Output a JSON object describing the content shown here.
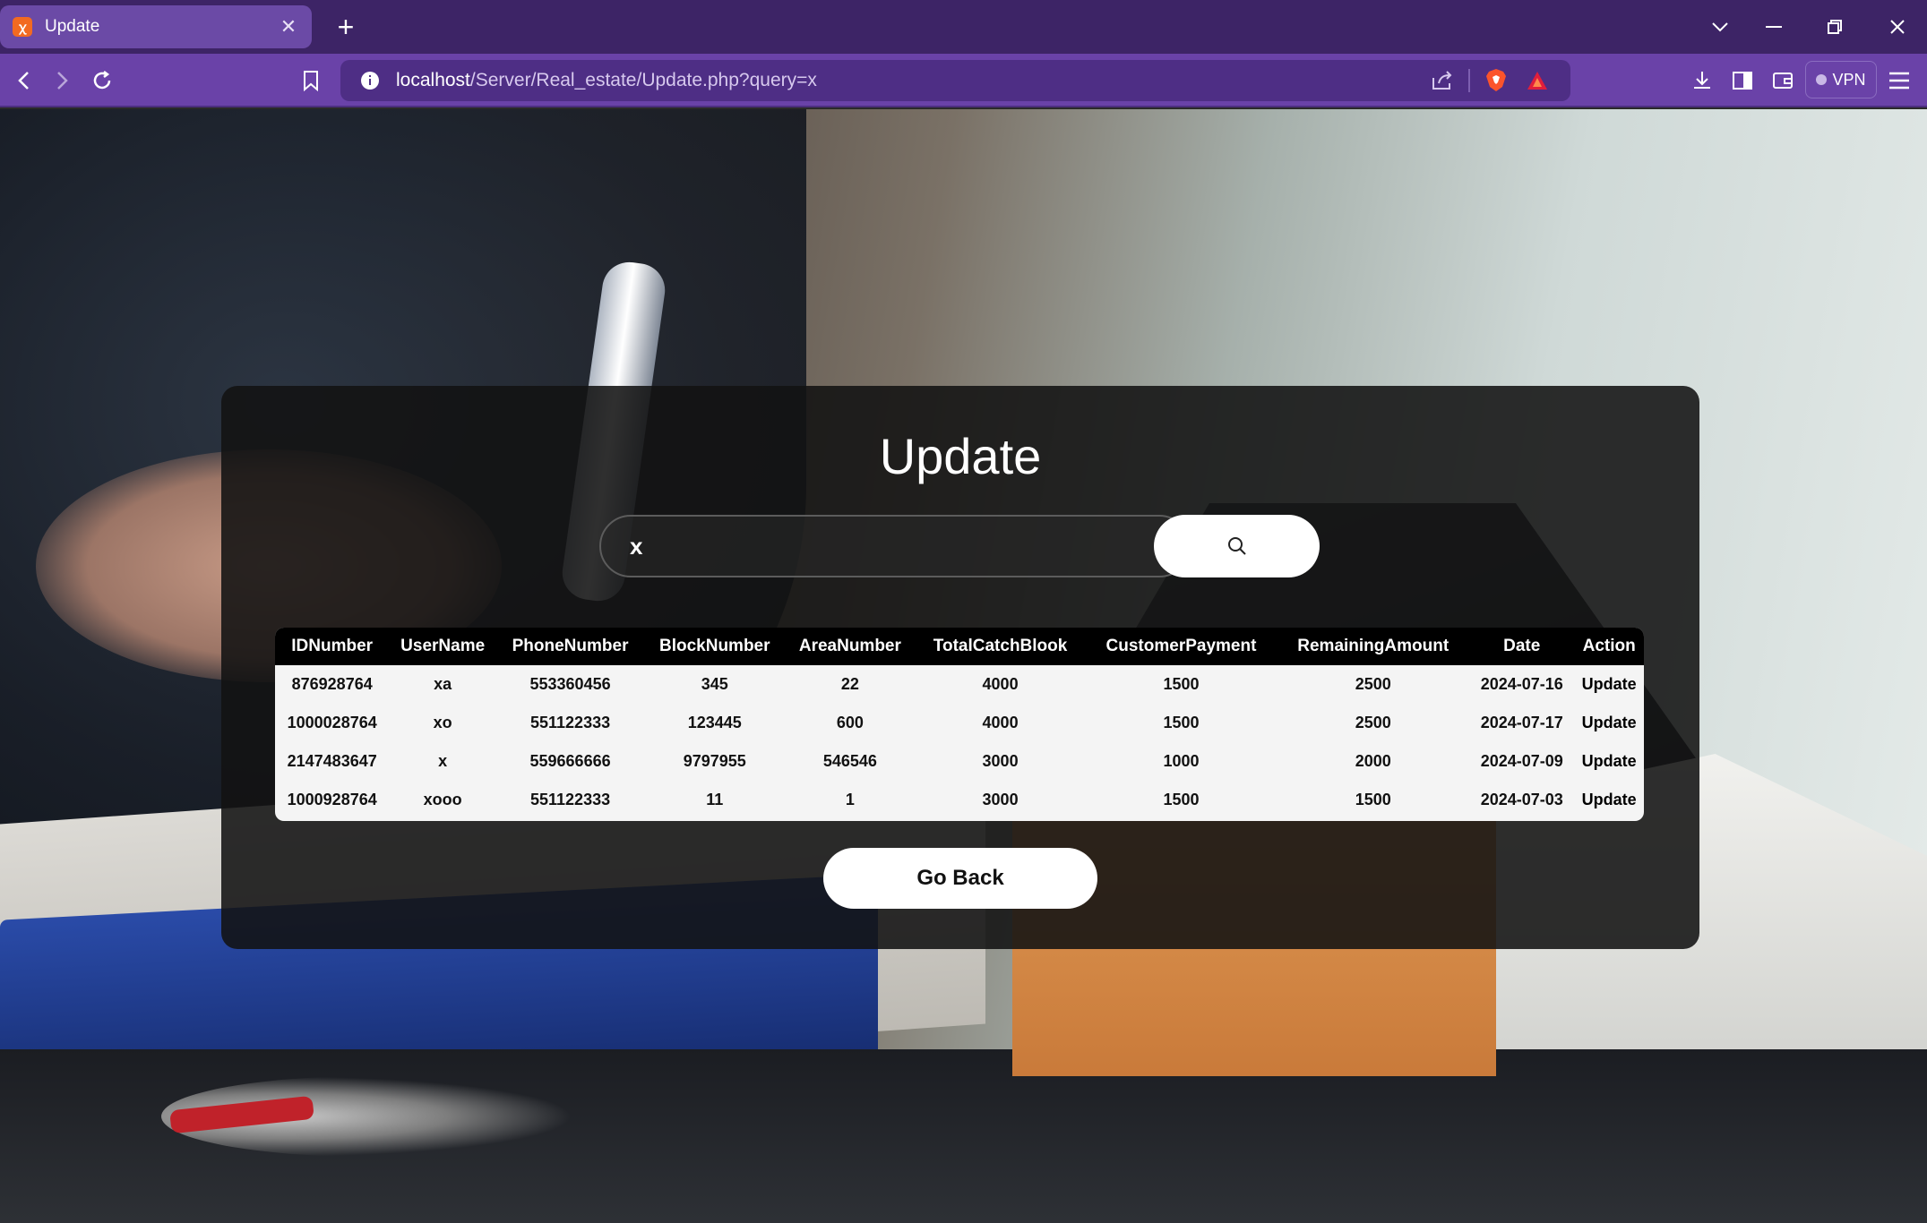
{
  "browser": {
    "tab_title": "Update",
    "url_host": "localhost",
    "url_path": "/Server/Real_estate/Update.php?query=x",
    "vpn_label": "VPN"
  },
  "page": {
    "title": "Update",
    "search": {
      "value": "x"
    },
    "table": {
      "headers": [
        "IDNumber",
        "UserName",
        "PhoneNumber",
        "BlockNumber",
        "AreaNumber",
        "TotalCatchBlook",
        "CustomerPayment",
        "RemainingAmount",
        "Date",
        "Action"
      ],
      "rows": [
        [
          "876928764",
          "xa",
          "553360456",
          "345",
          "22",
          "4000",
          "1500",
          "2500",
          "2024-07-16",
          "Update"
        ],
        [
          "1000028764",
          "xo",
          "551122333",
          "123445",
          "600",
          "4000",
          "1500",
          "2500",
          "2024-07-17",
          "Update"
        ],
        [
          "2147483647",
          "x",
          "559666666",
          "9797955",
          "546546",
          "3000",
          "1000",
          "2000",
          "2024-07-09",
          "Update"
        ],
        [
          "1000928764",
          "xooo",
          "551122333",
          "11",
          "1",
          "3000",
          "1500",
          "1500",
          "2024-07-03",
          "Update"
        ]
      ]
    },
    "back_button": "Go Back"
  },
  "colors": {
    "tabbar": "#3d2466",
    "navbar": "#6a42a8",
    "panel": "#121212",
    "accent": "#ffffff"
  }
}
